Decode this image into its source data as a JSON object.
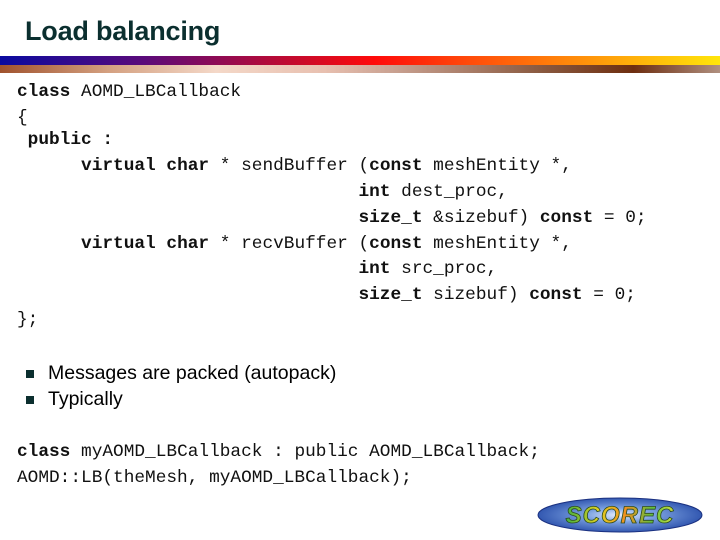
{
  "slide": {
    "title": "Load balancing",
    "code_block_1": {
      "line1": {
        "kw": "class",
        "rest": " AOMD_LBCallback"
      },
      "line2": "{",
      "line3": {
        "kw": " public :"
      },
      "line4": {
        "indent": "      ",
        "kw1": "virtual",
        "sp1": " ",
        "kw2": "char",
        "rest1": " * sendBuffer (",
        "kw3": "const",
        "rest2": " meshEntity *,"
      },
      "line5": {
        "indent": "                                ",
        "kw": "int",
        "rest": " dest_proc,"
      },
      "line6": {
        "indent": "                                ",
        "kw": "size_t",
        "rest": " &sizebuf) ",
        "kw2": "const",
        "rest2": " = 0;"
      },
      "line7": {
        "indent": "      ",
        "kw1": "virtual",
        "sp1": " ",
        "kw2": "char",
        "rest1": " * recvBuffer (",
        "kw3": "const",
        "rest2": " meshEntity *,"
      },
      "line8": {
        "indent": "                                ",
        "kw": "int",
        "rest": " src_proc,"
      },
      "line9": {
        "indent": "                                ",
        "kw": "size_t",
        "rest": " sizebuf) ",
        "kw2": "const",
        "rest2": " = 0;"
      },
      "line10": "};"
    },
    "bullets": [
      "Messages are packed (autopack)",
      "Typically"
    ],
    "code_block_2": {
      "line1": {
        "kw": "class",
        "rest": " myAOMD_LBCallback : public AOMD_LBCallback;"
      },
      "line2": "AOMD::LB(theMesh, myAOMD_LBCallback);"
    },
    "logo_text": "SCOREC",
    "colors": {
      "title": "#0b2f2f",
      "bullet": "#0b2f2f",
      "logo_blue": "#1a4fb0"
    }
  }
}
